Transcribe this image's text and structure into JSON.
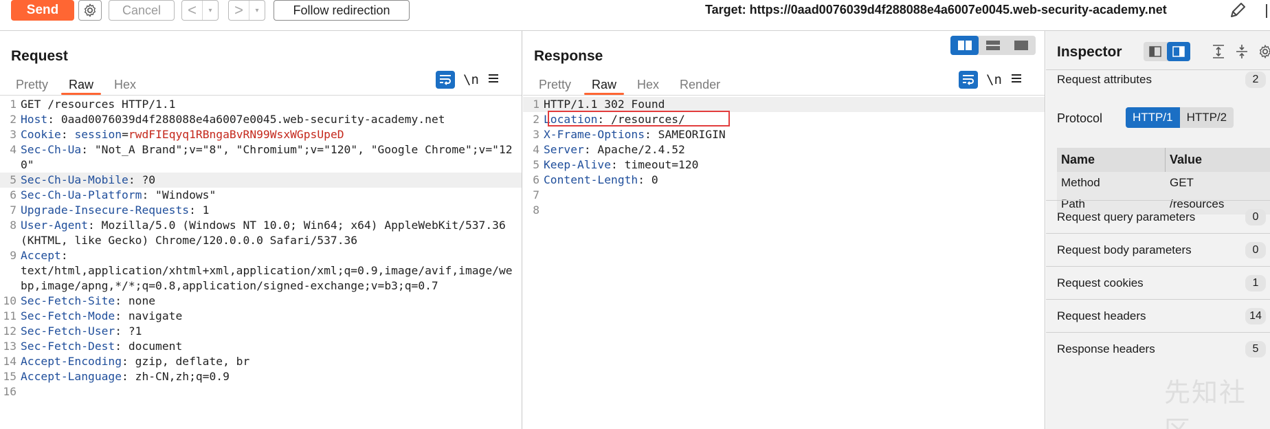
{
  "toolbar": {
    "send_label": "Send",
    "cancel_label": "Cancel",
    "back_icon": "<",
    "forward_icon": ">",
    "dropdown_icon": "▾",
    "follow_label": "Follow redirection",
    "target_text": "Target: https://0aad0076039d4f288088e4a6007e0045.web-security-academy.net"
  },
  "request": {
    "title": "Request",
    "tabs": [
      "Pretty",
      "Raw",
      "Hex"
    ],
    "active_tab": "Raw",
    "newline_label": "\\n"
  },
  "response": {
    "title": "Response",
    "tabs": [
      "Pretty",
      "Raw",
      "Hex",
      "Render"
    ],
    "active_tab": "Raw",
    "newline_label": "\\n"
  },
  "inspector": {
    "title": "Inspector",
    "request_attributes": {
      "label": "Request attributes",
      "count": "2"
    },
    "protocol_label": "Protocol",
    "protocol_options": [
      "HTTP/1",
      "HTTP/2"
    ],
    "protocol_selected": "HTTP/1",
    "table_headers": {
      "name": "Name",
      "value": "Value"
    },
    "attributes": [
      {
        "name": "Method",
        "value": "GET"
      },
      {
        "name": "Path",
        "value": "/resources"
      }
    ],
    "sections": [
      {
        "label": "Request query parameters",
        "count": "0"
      },
      {
        "label": "Request body parameters",
        "count": "0"
      },
      {
        "label": "Request cookies",
        "count": "1"
      },
      {
        "label": "Request headers",
        "count": "14"
      },
      {
        "label": "Response headers",
        "count": "5"
      }
    ],
    "watermark": "先知社区"
  },
  "colors": {
    "accent": "#ff6633",
    "blue": "#1b6fc4",
    "header_name": "#1f4e9b",
    "cookie_value": "#c4281c",
    "highlight_box": "#e23c3c"
  }
}
